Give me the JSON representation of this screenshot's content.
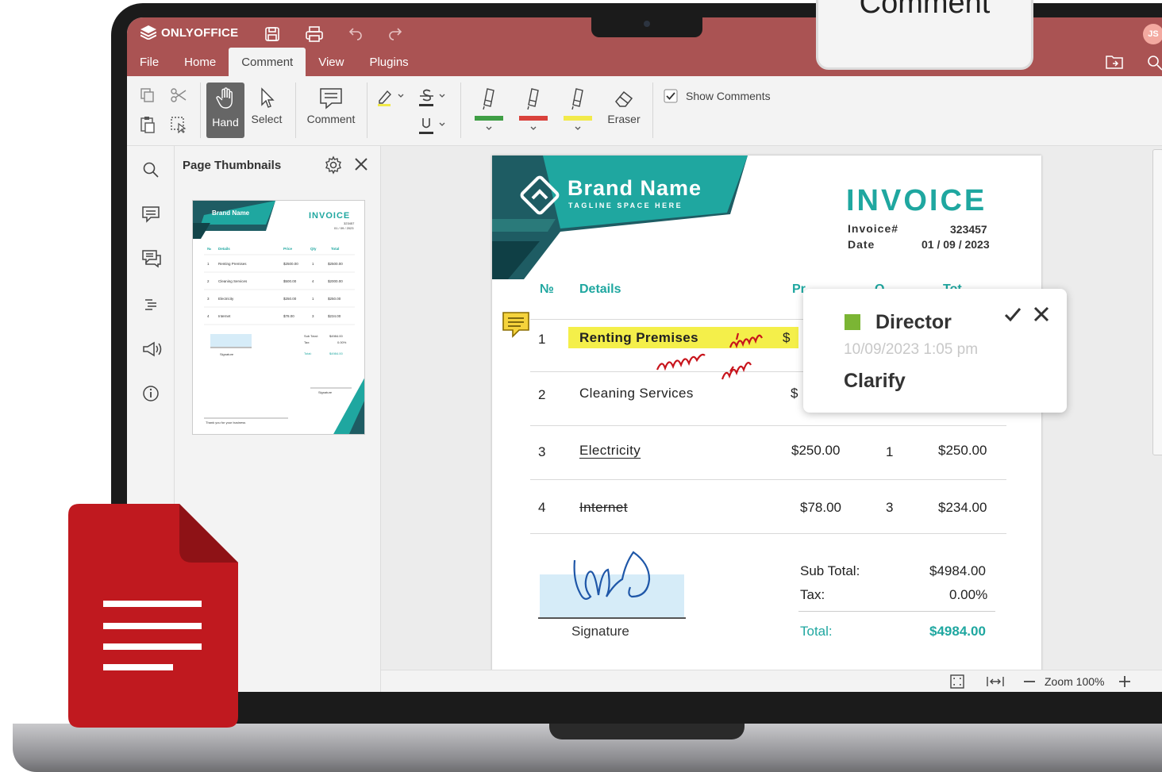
{
  "app": {
    "name": "ONLYOFFICE",
    "avatar_initials": "JS",
    "accent_color": "#aa5353"
  },
  "menu": {
    "tabs": [
      "File",
      "Home",
      "Comment",
      "View",
      "Plugins"
    ],
    "active_tab": "Comment"
  },
  "toolbar": {
    "hand_label": "Hand",
    "select_label": "Select",
    "comment_label": "Comment",
    "eraser_label": "Eraser",
    "show_comments_label": "Show Comments",
    "show_comments_checked": true,
    "highlighter_colors": [
      "#3f9e45",
      "#d9413b",
      "#f2ea4a"
    ]
  },
  "callout": {
    "label": "Comment"
  },
  "thumbnails": {
    "title": "Page Thumbnails"
  },
  "invoice": {
    "brand_name": "Brand Name",
    "tagline": "TAGLINE SPACE HERE",
    "title": "INVOICE",
    "invoice_label": "Invoice#",
    "invoice_number": "323457",
    "date_label": "Date",
    "date_value": "01 / 09 / 2023",
    "col_no": "№",
    "col_details": "Details",
    "col_price_partial": "Pr",
    "col_qty_partial": "Q",
    "col_total_partial": "Tot",
    "rows": [
      {
        "no": "1",
        "details": "Renting Premises",
        "price": "$",
        "qty": "",
        "total": ""
      },
      {
        "no": "2",
        "details": "Cleaning Services",
        "price": "$",
        "qty": "",
        "total": ""
      },
      {
        "no": "3",
        "details": "Electricity",
        "price": "$250.00",
        "qty": "1",
        "total": "$250.00"
      },
      {
        "no": "4",
        "details": "Internet",
        "price": "$78.00",
        "qty": "3",
        "total": "$234.00"
      }
    ],
    "subtotal_label": "Sub Total:",
    "subtotal_value": "$4984.00",
    "tax_label": "Tax:",
    "tax_value": "0.00%",
    "total_label": "Total:",
    "total_value": "$4984.00",
    "signature_label": "Signature"
  },
  "comment": {
    "author": "Director",
    "timestamp": "10/09/2023 1:05 pm",
    "text": "Clarify",
    "author_color": "#7bb534"
  },
  "statusbar": {
    "zoom_label": "Zoom 100%"
  },
  "thumb_mini": {
    "brand_name": "Brand Name",
    "title": "INVOICE",
    "invoice_number": "323457",
    "date_value": "01 / 09 / 2023",
    "col_no": "№",
    "col_details": "Details",
    "col_price": "Price",
    "col_qty": "Qty",
    "col_total": "Total",
    "rows": [
      {
        "no": "1",
        "details": "Renting Premises",
        "price": "$2500.00",
        "qty": "1",
        "total": "$2500.00"
      },
      {
        "no": "2",
        "details": "Cleaning Services",
        "price": "$500.00",
        "qty": "4",
        "total": "$2000.00"
      },
      {
        "no": "3",
        "details": "Electricity",
        "price": "$250.00",
        "qty": "1",
        "total": "$250.00"
      },
      {
        "no": "4",
        "details": "Internet",
        "price": "$78.00",
        "qty": "3",
        "total": "$234.00"
      }
    ],
    "subtotal_label": "Sub Total:",
    "subtotal_value": "$4984.00",
    "tax_label": "Tax:",
    "tax_value": "0.00%",
    "total_label": "Total:",
    "total_value": "$4984.00",
    "signature_left": "Signature",
    "signature_right": "Signature",
    "thanks": "Thank you for your business"
  }
}
